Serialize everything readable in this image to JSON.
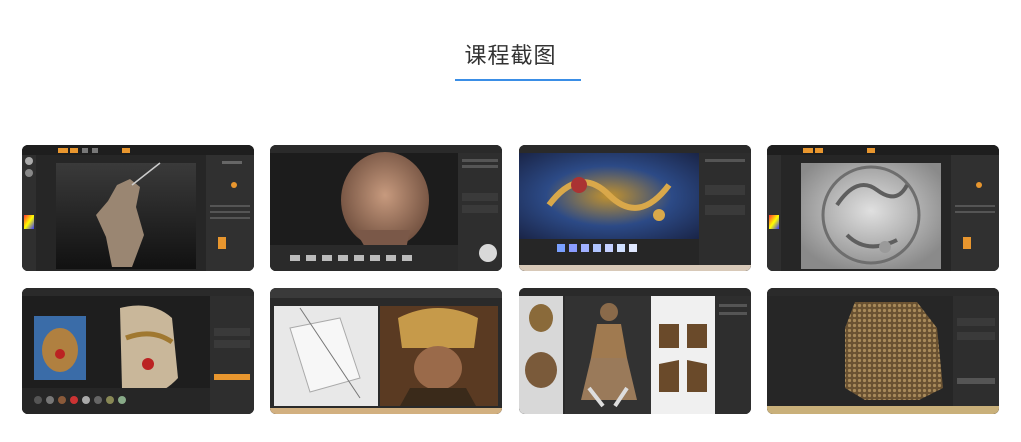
{
  "section": {
    "title": "课程截图"
  },
  "colors": {
    "accent": "#3a8ee6",
    "ui_dark": "#2b2b2b",
    "ui_panel": "#1f1f1f",
    "ui_orange": "#e8962e"
  },
  "screenshots": [
    {
      "subject": "zbrush-warrior-sculpt"
    },
    {
      "subject": "bald-head-render"
    },
    {
      "subject": "dragon-texture-paint"
    },
    {
      "subject": "dragon-relief-sculpt"
    },
    {
      "subject": "helmet-texture-paint"
    },
    {
      "subject": "samurai-reference-compare"
    },
    {
      "subject": "uv-layout-figure"
    },
    {
      "subject": "chainmail-armor-render"
    }
  ]
}
